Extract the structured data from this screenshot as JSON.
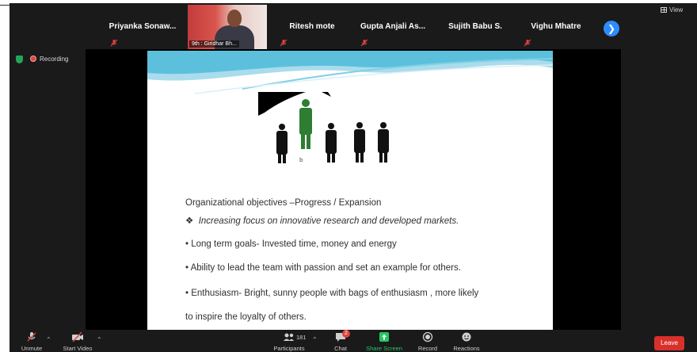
{
  "gallery": {
    "tiles": [
      {
        "name": "Priyanka  Sonaw..."
      },
      {
        "caption": "9th : Giridhar Bh..."
      },
      {
        "name": "Ritesh mote"
      },
      {
        "name": "Gupta Anjali As..."
      },
      {
        "name": "Sujith Babu S."
      },
      {
        "name": "Vighu Mhatre"
      }
    ],
    "next_icon": "chevron-right-icon",
    "view_label": "View"
  },
  "recording": {
    "label": "Recording"
  },
  "slide": {
    "heading": "Organizational objectives –Progress / Expansion",
    "bullet_symbol": "❖",
    "italic_point": "Increasing focus on innovative research and developed markets.",
    "points": [
      "• Long term goals- Invested time, money and energy",
      "• Ability to lead the team with passion and set an example for others.",
      "• Enthusiasm- Bright, sunny people with bags of enthusiasm , more likely",
      "to inspire the loyalty of others."
    ],
    "art_caption": "b"
  },
  "toolbar": {
    "unmute": "Unmute",
    "start_video": "Start Video",
    "participants": "Participants",
    "participants_count": "181",
    "chat": "Chat",
    "chat_badge": "2",
    "share_screen": "Share Screen",
    "record": "Record",
    "reactions": "Reactions",
    "leave": "Leave"
  },
  "colors": {
    "accent": "#2d8cff",
    "leave": "#d9302c",
    "share": "#23c860",
    "recording": "#e0443e",
    "security": "#23a45a"
  }
}
